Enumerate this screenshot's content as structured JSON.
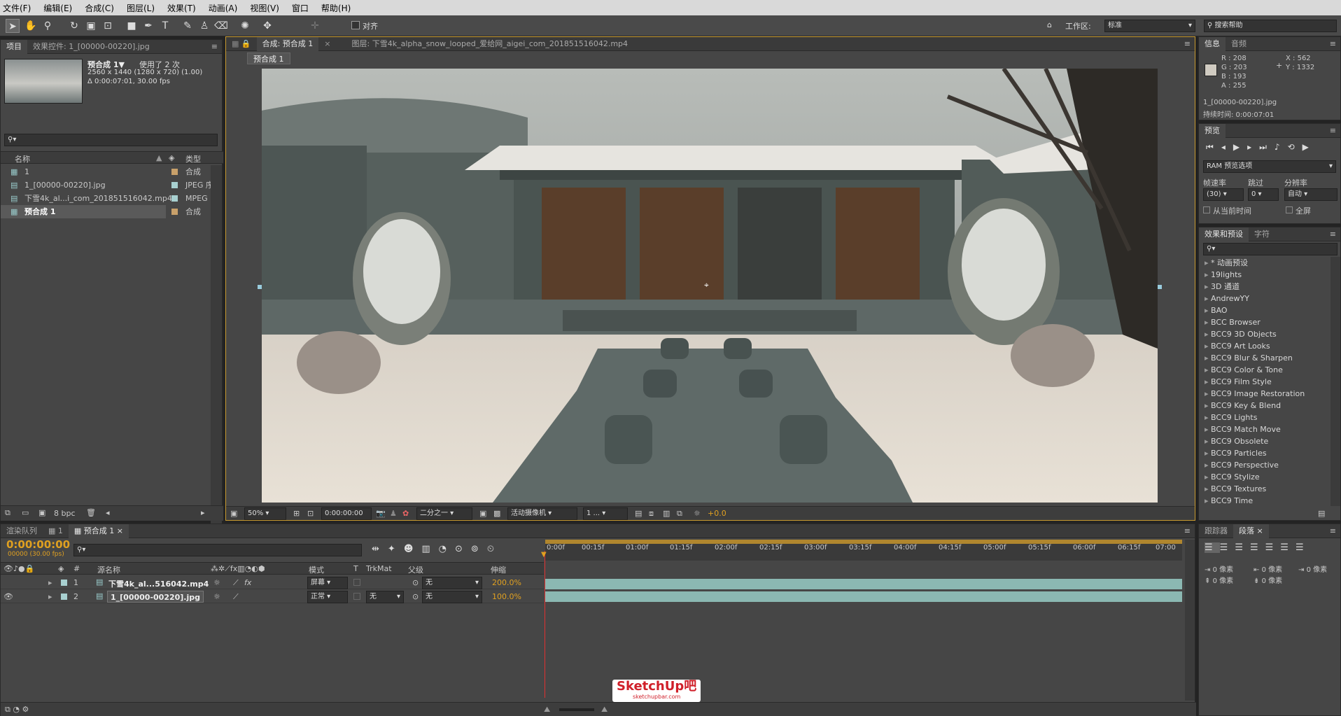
{
  "menu": [
    "文件(F)",
    "编辑(E)",
    "合成(C)",
    "图层(L)",
    "效果(T)",
    "动画(A)",
    "视图(V)",
    "窗口",
    "帮助(H)"
  ],
  "toolbar": {
    "align_label": "对齐",
    "workspace_label": "工作区:",
    "workspace_value": "标准",
    "search_placeholder": "搜索帮助"
  },
  "project": {
    "tabs": [
      "项目",
      "效果控件: 1_[00000-00220].jpg"
    ],
    "selected_name": "预合成 1▼",
    "used_count": "使用了 2 次",
    "size_line": "2560 x 1440 (1280 x 720) (1.00)",
    "duration_line": "Δ 0:00:07:01, 30.00 fps",
    "search_placeholder": "",
    "col_name": "名称",
    "col_type": "类型",
    "items": [
      {
        "name": "1",
        "type": "合成",
        "color": "#c8a06a",
        "selected": false
      },
      {
        "name": "1_[00000-00220].jpg",
        "type": "JPEG 序",
        "color": "#a8d0d0",
        "selected": false
      },
      {
        "name": "下雪4k_al...i_com_201851516042.mp4",
        "type": "MPEG",
        "color": "#a8d0d0",
        "selected": false
      },
      {
        "name": "预合成 1",
        "type": "合成",
        "color": "#c8a06a",
        "selected": true
      }
    ],
    "bpc": "8 bpc"
  },
  "viewer": {
    "tabs": [
      "合成: 预合成 1",
      "图层: 下雪4k_alpha_snow_looped_爱给网_aigei_com_201851516042.mp4"
    ],
    "breadcrumb": "预合成 1",
    "zoom": "50%",
    "timecode": "0:00:00:00",
    "resolution": "二分之一",
    "camera": "活动摄像机",
    "views": "1 ...",
    "exposure": "+0.0"
  },
  "info": {
    "tabs": [
      "信息",
      "音频"
    ],
    "r": "R : 208",
    "g": "G : 203",
    "b": "B : 193",
    "a": "A : 255",
    "x": "X : 562",
    "y": "Y : 1332",
    "filename": "1_[00000-00220].jpg",
    "duration": "持续时间: 0:00:07:01",
    "swatch_color": "#d0cbc1"
  },
  "preview": {
    "tab": "预览",
    "ram_options": "RAM 预览选项",
    "frame_rate_label": "帧速率",
    "skip_label": "跳过",
    "resolution_label": "分辨率",
    "frame_rate_value": "(30)",
    "skip_value": "0",
    "resolution_value": "自动",
    "from_current": "从当前时间",
    "fullscreen": "全屏"
  },
  "effects": {
    "tabs": [
      "效果和预设",
      "字符"
    ],
    "search_placeholder": "",
    "items": [
      "* 动画预设",
      "19lights",
      "3D 通道",
      "AndrewYY",
      "BAO",
      "BCC Browser",
      "BCC9 3D Objects",
      "BCC9 Art Looks",
      "BCC9 Blur & Sharpen",
      "BCC9 Color & Tone",
      "BCC9 Film Style",
      "BCC9 Image Restoration",
      "BCC9 Key & Blend",
      "BCC9 Lights",
      "BCC9 Match Move",
      "BCC9 Obsolete",
      "BCC9 Particles",
      "BCC9 Perspective",
      "BCC9 Stylize",
      "BCC9 Textures",
      "BCC9 Time"
    ]
  },
  "timeline": {
    "tabs": [
      "渲染队列",
      "1",
      "预合成 1"
    ],
    "timecode": "0:00:00:00",
    "fps_line": "00000 (30.00 fps)",
    "search_placeholder": "",
    "col_num": "#",
    "col_source": "源名称",
    "col_mode": "模式",
    "col_t": "T",
    "col_trkmat": "TrkMat",
    "col_parent": "父级",
    "col_stretch": "伸缩",
    "ruler": [
      "0:00f",
      "00:15f",
      "01:00f",
      "01:15f",
      "02:00f",
      "02:15f",
      "03:00f",
      "03:15f",
      "04:00f",
      "04:15f",
      "05:00f",
      "05:15f",
      "06:00f",
      "06:15f",
      "07:00"
    ],
    "layers": [
      {
        "num": "1",
        "name": "下雪4k_al...516042.mp4",
        "mode": "屏幕",
        "trkmat": "",
        "parent": "无",
        "stretch": "200.0%",
        "color": "#a8d0d0"
      },
      {
        "num": "2",
        "name": "1_[00000-00220].jpg",
        "mode": "正常",
        "trkmat": "无",
        "parent": "无",
        "stretch": "100.0%",
        "color": "#a8d0d0"
      }
    ]
  },
  "paragraph": {
    "tabs": [
      "跟踪器",
      "段落"
    ],
    "indent_left": "0 像素",
    "indent_first": "0 像素",
    "indent_right": "0 像素",
    "space_before": "0 像素",
    "space_after": "0 像素"
  },
  "watermark": {
    "text": "SketchUp吧",
    "sub": "sketchupbar.com"
  }
}
